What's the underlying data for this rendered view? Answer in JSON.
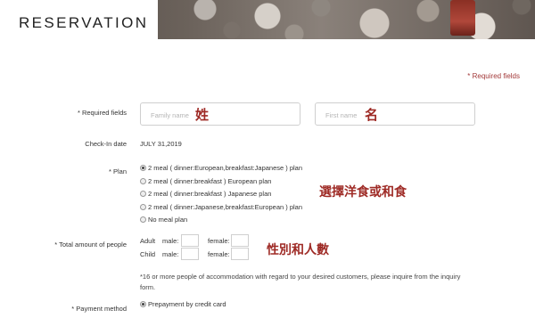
{
  "header": {
    "title": "RESERVATION"
  },
  "required_note": "* Required fields",
  "name_row": {
    "label": "* Required fields",
    "family_placeholder": "Family name",
    "family_annotation": "姓",
    "first_placeholder": "First name",
    "first_annotation": "名"
  },
  "checkin": {
    "label": "Check-In date",
    "value": "JULY 31,2019"
  },
  "plan": {
    "label": "* Plan",
    "options": [
      {
        "label": "2 meal ( dinner:European,breakfast:Japanese ) plan",
        "selected": true
      },
      {
        "label": "2 meal ( dinner:breakfast ) European plan",
        "selected": false
      },
      {
        "label": "2 meal ( dinner:breakfast ) Japanese plan",
        "selected": false
      },
      {
        "label": "2 meal ( dinner:Japanese,breakfast:European ) plan",
        "selected": false
      },
      {
        "label": "No meal plan",
        "selected": false
      }
    ],
    "annotation": "選擇洋食或和食"
  },
  "people": {
    "label": "* Total amount of people",
    "adult": "Adult",
    "child": "Child",
    "male": "male:",
    "female": "female:",
    "annotation": "性別和人數",
    "note": "*16 or more people of accommodation with regard to your desired customers, please inquire from the inquiry form."
  },
  "payment": {
    "label": "* Payment method",
    "option": "Prepayment by credit card"
  },
  "colors": {
    "accent": "#a33a3a",
    "annotation": "#9e2a25"
  }
}
